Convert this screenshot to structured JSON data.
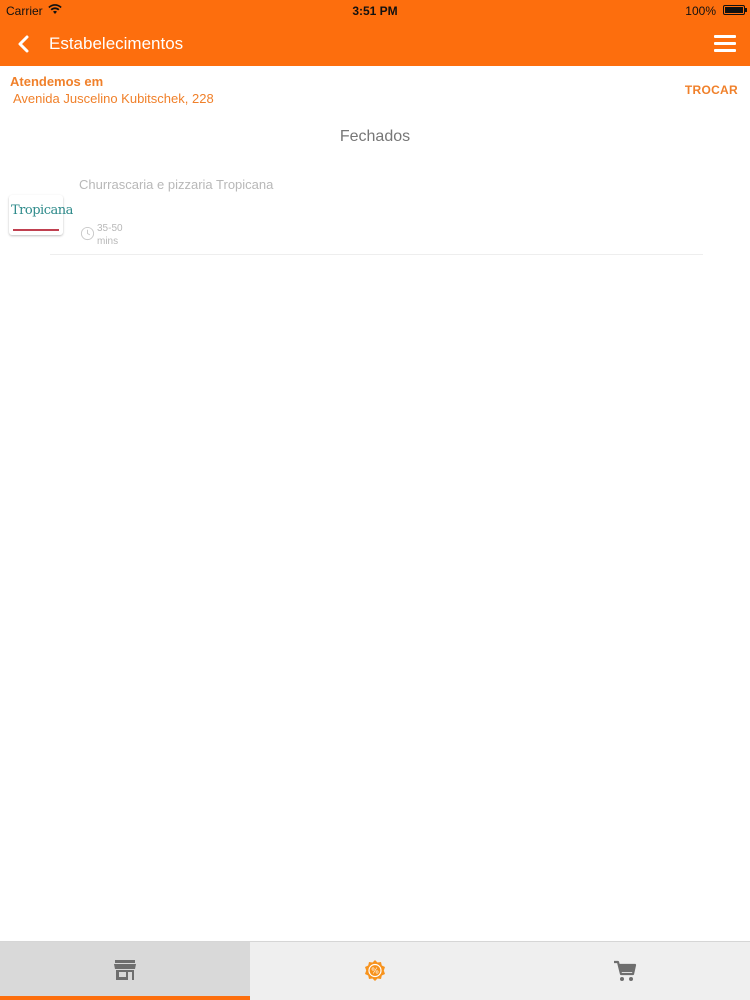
{
  "status_bar": {
    "carrier": "Carrier",
    "time": "3:51 PM",
    "battery": "100%"
  },
  "nav": {
    "title": "Estabelecimentos",
    "back_icon": "chevron-left-icon",
    "menu_icon": "hamburger-menu-icon"
  },
  "address": {
    "label": "Atendemos em",
    "value": "Avenida Juscelino Kubitschek, 228",
    "change_label": "TROCAR"
  },
  "section": {
    "title": "Fechados"
  },
  "stores": [
    {
      "name": "Churrascaria e pizzaria Tropicana",
      "logo_text": "Tropicana",
      "time_range": "35-50",
      "time_unit": "mins"
    }
  ],
  "tabs": [
    {
      "icon": "store-icon",
      "active": true
    },
    {
      "icon": "discount-badge-icon",
      "active": false
    },
    {
      "icon": "cart-icon",
      "active": false
    }
  ],
  "colors": {
    "primary": "#fd6e0d",
    "accent_text": "#f0802a"
  }
}
